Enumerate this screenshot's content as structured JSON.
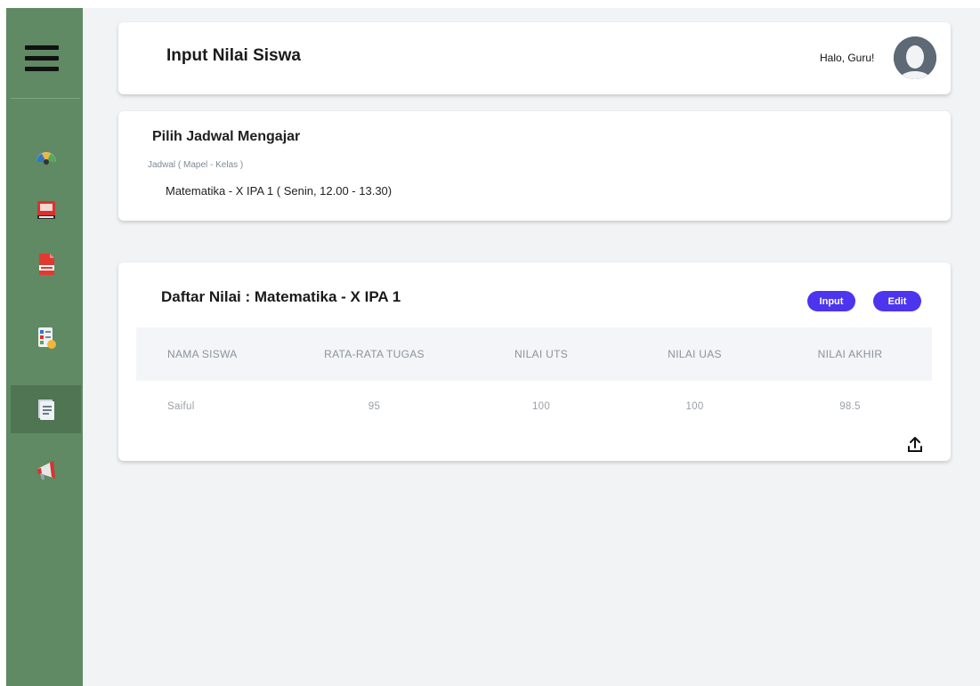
{
  "header": {
    "title": "Input Nilai Siswa",
    "greeting": "Halo, Guru!"
  },
  "sidebar": {
    "menu_icon": "hamburger-menu-icon",
    "items": [
      {
        "icon": "dashboard-gauge-icon"
      },
      {
        "icon": "book-icon"
      },
      {
        "icon": "report-document-icon"
      },
      {
        "icon": "schedule-list-icon"
      },
      {
        "icon": "grade-document-icon",
        "active": true
      },
      {
        "icon": "megaphone-icon"
      }
    ]
  },
  "jadwal": {
    "title": "Pilih Jadwal Mengajar",
    "label": "Jadwal ( Mapel - Kelas )",
    "value": "Matematika - X IPA 1 ( Senin, 12.00 - 13.30)"
  },
  "nilai": {
    "title": "Daftar Nilai : Matematika - X IPA 1",
    "input_label": "Input",
    "edit_label": "Edit",
    "columns": [
      "NAMA SISWA",
      "RATA-RATA TUGAS",
      "NILAI UTS",
      "NILAI UAS",
      "NILAI AKHIR"
    ],
    "rows": [
      [
        "Saiful",
        "95",
        "100",
        "100",
        "98.5"
      ]
    ],
    "upload_icon": "upload-icon"
  },
  "colors": {
    "sidebar": "#5f8a63",
    "sidebar_active": "#4f7553",
    "button": "#4d34ee",
    "background": "#f2f3f5"
  }
}
